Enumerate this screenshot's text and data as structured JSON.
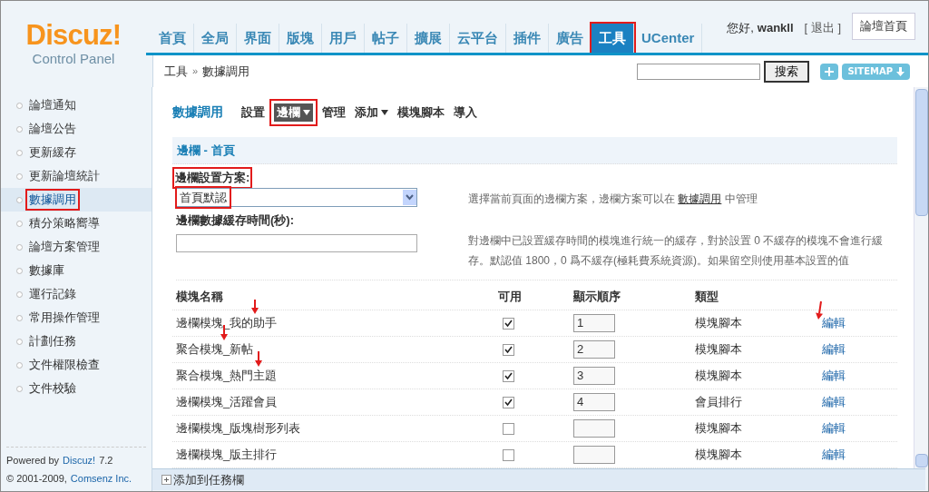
{
  "logo": {
    "name": "Discuz!",
    "subtitle": "Control Panel"
  },
  "nav": [
    {
      "label": "首頁",
      "selected": false,
      "annotated": false
    },
    {
      "label": "全局",
      "selected": false,
      "annotated": false
    },
    {
      "label": "界面",
      "selected": false,
      "annotated": false
    },
    {
      "label": "版塊",
      "selected": false,
      "annotated": false
    },
    {
      "label": "用戶",
      "selected": false,
      "annotated": false
    },
    {
      "label": "帖子",
      "selected": false,
      "annotated": false
    },
    {
      "label": "擴展",
      "selected": false,
      "annotated": false
    },
    {
      "label": "云平台",
      "selected": false,
      "annotated": false
    },
    {
      "label": "插件",
      "selected": false,
      "annotated": false
    },
    {
      "label": "廣告",
      "selected": false,
      "annotated": false
    },
    {
      "label": "工具",
      "selected": true,
      "annotated": true
    },
    {
      "label": "UCenter",
      "selected": false,
      "annotated": false
    }
  ],
  "user": {
    "greeting": "您好,",
    "username": "wankll",
    "logout": "[ 退出 ]"
  },
  "home_button": "論壇首頁",
  "breadcrumb": {
    "items": [
      "工具",
      "數據調用"
    ],
    "separator": "»"
  },
  "search": {
    "button": "搜索"
  },
  "sitemap": {
    "label": "SITEMAP"
  },
  "sidebar": {
    "items": [
      {
        "label": "論壇通知",
        "selected": false,
        "annotated": false
      },
      {
        "label": "論壇公告",
        "selected": false,
        "annotated": false
      },
      {
        "label": "更新緩存",
        "selected": false,
        "annotated": false
      },
      {
        "label": "更新論壇統計",
        "selected": false,
        "annotated": false
      },
      {
        "label": "數據調用",
        "selected": true,
        "annotated": true
      },
      {
        "label": "積分策略嚮導",
        "selected": false,
        "annotated": false
      },
      {
        "label": "論壇方案管理",
        "selected": false,
        "annotated": false
      },
      {
        "label": "數據庫",
        "selected": false,
        "annotated": false
      },
      {
        "label": "運行記錄",
        "selected": false,
        "annotated": false
      },
      {
        "label": "常用操作管理",
        "selected": false,
        "annotated": false
      },
      {
        "label": "計劃任務",
        "selected": false,
        "annotated": false
      },
      {
        "label": "文件權限檢查",
        "selected": false,
        "annotated": false
      },
      {
        "label": "文件校驗",
        "selected": false,
        "annotated": false
      }
    ],
    "powered_by": {
      "text": "Powered by",
      "link": "Discuz!",
      "version": "7.2"
    },
    "copyright": {
      "text": "© 2001-2009,",
      "link": "Comsenz Inc."
    }
  },
  "page": {
    "title": "數據調用",
    "tabs": [
      {
        "label": "設置",
        "selected": false,
        "dropdown": false,
        "annotated": false
      },
      {
        "label": "邊欄",
        "selected": true,
        "dropdown": true,
        "annotated": true
      },
      {
        "label": "管理",
        "selected": false,
        "dropdown": false,
        "annotated": false
      },
      {
        "label": "添加",
        "selected": false,
        "dropdown": true,
        "annotated": false
      },
      {
        "label": "模塊腳本",
        "selected": false,
        "dropdown": false,
        "annotated": false
      },
      {
        "label": "導入",
        "selected": false,
        "dropdown": false,
        "annotated": false
      }
    ]
  },
  "section": {
    "title": "邊欄 - 首頁",
    "fields": [
      {
        "kind": "select",
        "label": "邊欄設置方案:",
        "label_annotated": true,
        "value": "首頁默認",
        "value_annotated": true,
        "hint": "選擇當前頁面的邊欄方案，邊欄方案可以在",
        "hint_link": "數據調用",
        "hint_after": "中管理"
      },
      {
        "kind": "text",
        "label": "邊欄數據緩存時間(秒):",
        "label_annotated": false,
        "hint": "對邊欄中已設置緩存時間的模塊進行統一的緩存，對於設置 0 不緩存的模塊不會進行緩存。默認值 1800，0 爲不緩存(極耗費系統資源)。如果留空則使用基本設置的值"
      }
    ]
  },
  "table": {
    "columns": [
      "模塊名稱",
      "可用",
      "顯示順序",
      "類型"
    ],
    "rows": [
      {
        "name": "邊欄模塊_我的助手",
        "checked": true,
        "order": "1",
        "type": "模塊腳本",
        "action": "編輯"
      },
      {
        "name": "聚合模塊_新帖",
        "checked": true,
        "order": "2",
        "type": "模塊腳本",
        "action": "編輯"
      },
      {
        "name": "聚合模塊_熱門主題",
        "checked": true,
        "order": "3",
        "type": "模塊腳本",
        "action": "編輯"
      },
      {
        "name": "邊欄模塊_活躍會員",
        "checked": true,
        "order": "4",
        "type": "會員排行",
        "action": "編輯"
      },
      {
        "name": "邊欄模塊_版塊樹形列表",
        "checked": false,
        "type": "模塊腳本",
        "action": "編輯"
      },
      {
        "name": "邊欄模塊_版主排行",
        "checked": false,
        "type": "模塊腳本",
        "action": "編輯"
      }
    ]
  },
  "taskbar": {
    "label": "添加到任務欄"
  }
}
